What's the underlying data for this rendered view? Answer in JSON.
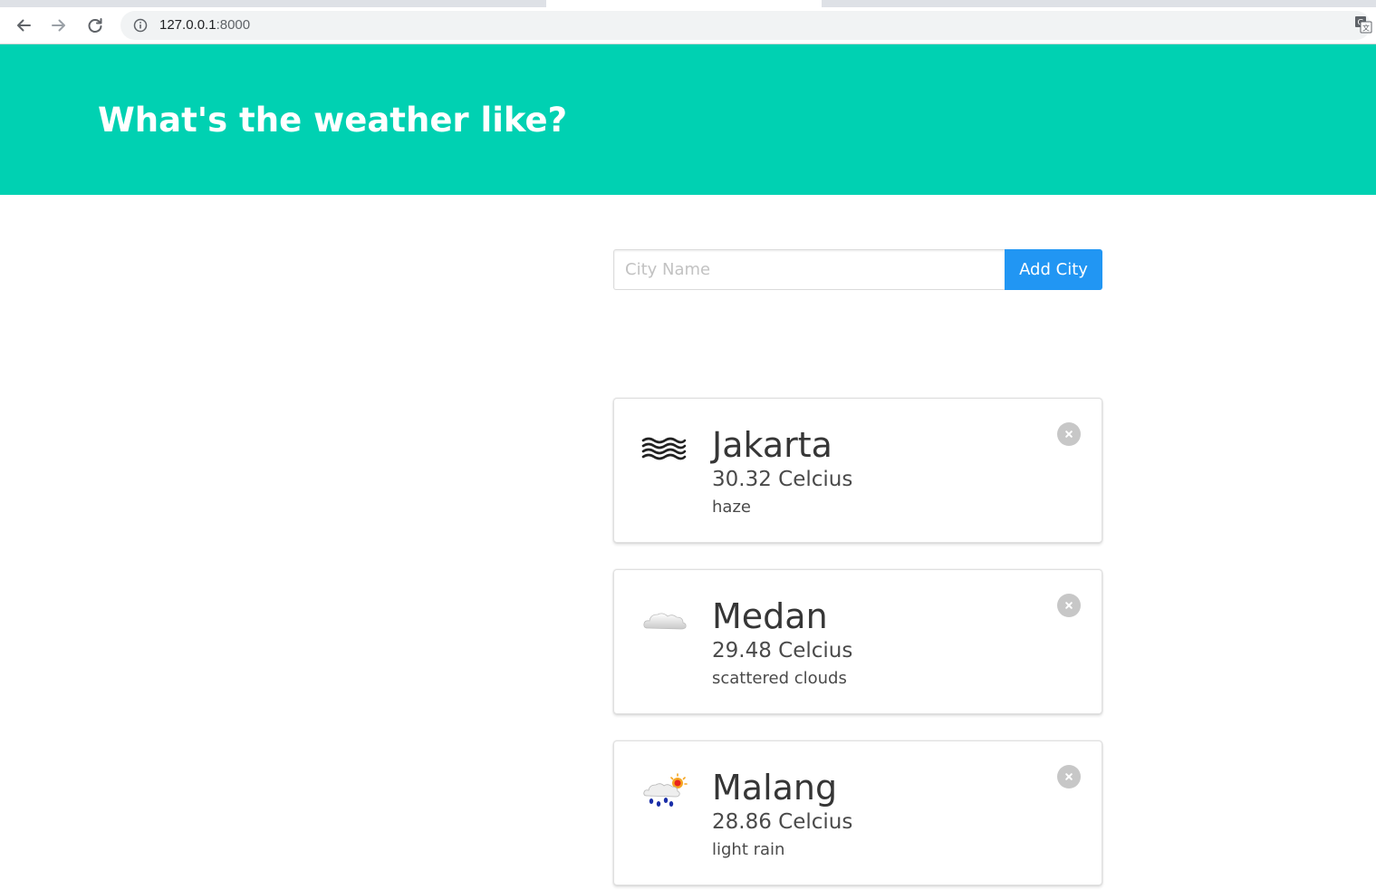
{
  "browser": {
    "url_host": "127.0.0.1",
    "url_port": ":8000",
    "icons": [
      "back-arrow-icon",
      "forward-arrow-icon",
      "reload-icon",
      "info-icon",
      "translate-icon"
    ]
  },
  "hero": {
    "title": "What's the weather like?",
    "color": "#00d1b2"
  },
  "form": {
    "placeholder": "City Name",
    "value": "",
    "button_label": "Add City",
    "button_color": "#2196f3"
  },
  "cities": [
    {
      "name": "Jakarta",
      "temperature": "30.32 Celcius",
      "description": "haze",
      "icon": "haze-icon"
    },
    {
      "name": "Medan",
      "temperature": "29.48 Celcius",
      "description": "scattered clouds",
      "icon": "cloud-icon"
    },
    {
      "name": "Malang",
      "temperature": "28.86 Celcius",
      "description": "light rain",
      "icon": "rain-sun-icon"
    }
  ]
}
